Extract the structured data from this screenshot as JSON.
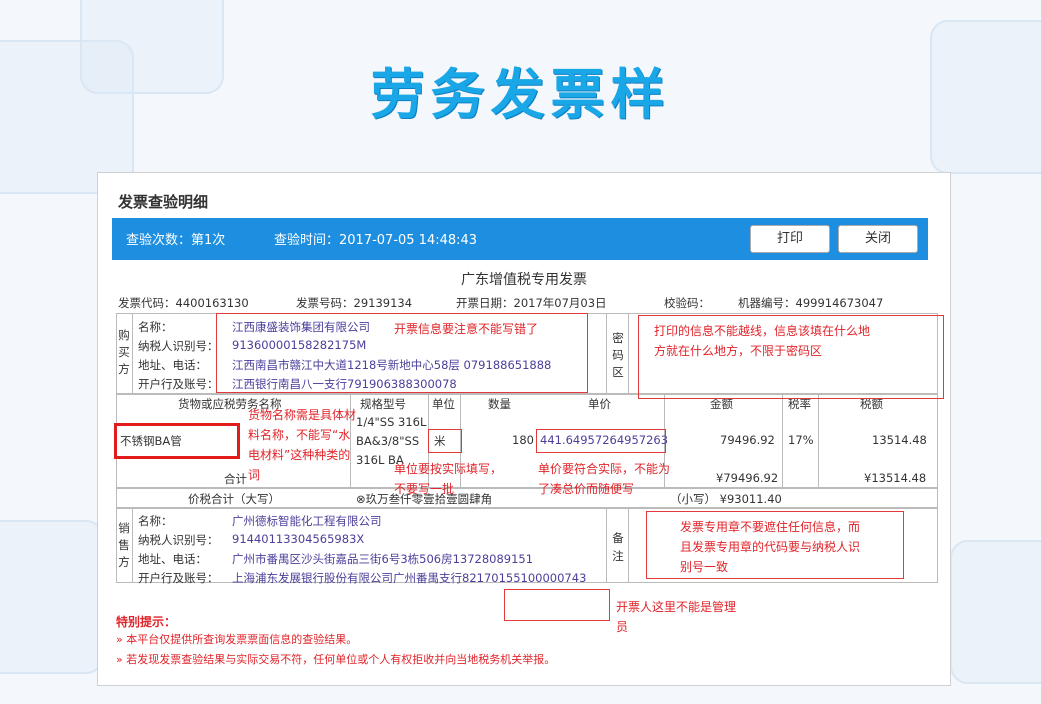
{
  "slide": {
    "title": "劳务发票样"
  },
  "panel": {
    "title": "发票查验明细",
    "bar": {
      "count_text": "查验次数：第1次",
      "time_text": "查验时间：2017-07-05 14:48:43",
      "print_label": "打印",
      "close_label": "关闭"
    },
    "invoice_title": "广东增值税专用发票",
    "meta": {
      "code": "发票代码：4400163130",
      "number": "发票号码：29139134",
      "date": "开票日期：2017年07月03日",
      "check": "校验码：",
      "machine": "机器编号：499914673047"
    },
    "buyer": {
      "side_label": [
        "购",
        "买",
        "方"
      ],
      "name_label": "名称：",
      "tax_label": "纳税人识别号：",
      "addr_label": "地址、电话：",
      "bank_label": "开户行及账号：",
      "name": "江西康盛装饰集团有限公司",
      "tax_id": "91360000158282175M",
      "addr": "江西南昌市赣江中大道1218号新地中心58层 079188651888",
      "bank": "江西银行南昌八一支行791906388300078"
    },
    "pwd_label": [
      "密",
      "码",
      "区"
    ],
    "items": {
      "headers": {
        "name": "货物或应税劳务名称",
        "spec": "规格型号",
        "unit": "单位",
        "qty": "数量",
        "price": "单价",
        "amount": "金额",
        "rate": "税率",
        "tax": "税额"
      },
      "row": {
        "name": "不锈钢BA管",
        "spec_lines": [
          "1/4\"SS 316L",
          "BA&3/8\"SS",
          "316L BA"
        ],
        "unit": "米",
        "qty": "180",
        "price": "441.64957264957263",
        "amount": "79496.92",
        "rate": "17%",
        "tax": "13514.48"
      },
      "subtotal_label": "合计",
      "subtotal_amount": "¥79496.92",
      "subtotal_tax": "¥13514.48",
      "total_label": "价税合计（大写）",
      "total_upper": "⊗玖万叁仟零壹拾壹圆肆角",
      "total_small": "（小写）  ¥93011.40"
    },
    "seller": {
      "side_label": [
        "销",
        "售",
        "方"
      ],
      "name_label": "名称：",
      "tax_label": "纳税人识别号：",
      "addr_label": "地址、电话：",
      "bank_label": "开户行及账号：",
      "name": "广州德标智能化工程有限公司",
      "tax_id": "91440113304565983X",
      "addr": "广州市番禺区沙头街嘉品三街6号3栋506房13728089151",
      "bank": "上海浦东发展银行股份有限公司广州番禺支行82170155100000743"
    },
    "remark_label": [
      "备",
      "注"
    ],
    "annotations": {
      "buyer_note": "开票信息要注意不能写错了",
      "pwd_note": "打印的信息不能越线，信息该填在什么地方就在什么地方，不限于密码区",
      "name_note": "货物名称需是具体材料名称，不能写“水电材料”这种种类的词",
      "unit_note": "单位要按实际填写，不要写一批",
      "price_note": "单价要符合实际，不能为了凑总价而随便写",
      "stamp_note": "发票专用章不要遮住任何信息，而且发票专用章的代码要与纳税人识别号一致",
      "drawer_note": "开票人这里不能是管理员"
    },
    "tips": {
      "title": "特别提示：",
      "line1": "» 本平台仅提供所查询发票票面信息的查验结果。",
      "line2": "» 若发现发票查验结果与实际交易不符，任何单位或个人有权拒收并向当地税务机关举报。"
    }
  }
}
